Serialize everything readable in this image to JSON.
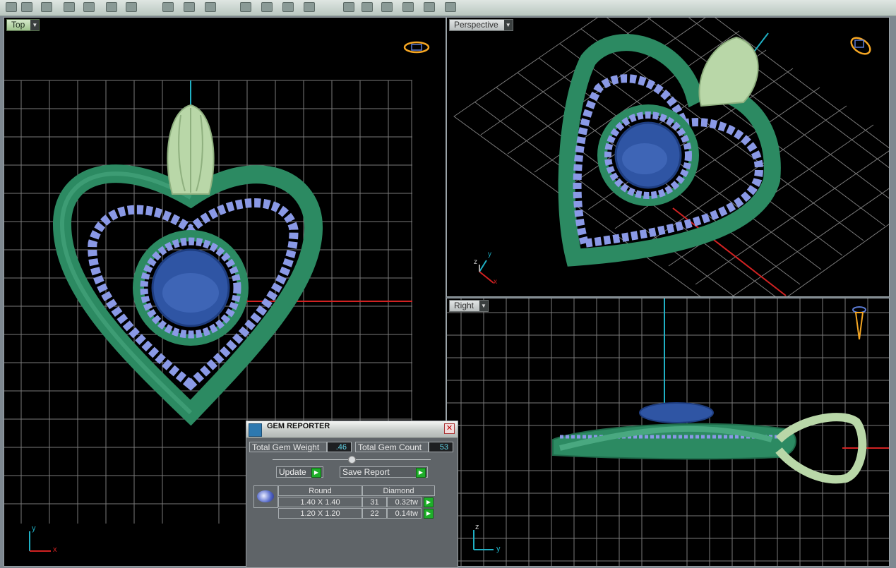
{
  "viewports": {
    "top": {
      "label": "Top"
    },
    "perspective": {
      "label": "Perspective"
    },
    "right": {
      "label": "Right"
    }
  },
  "axes": {
    "x": "x",
    "y": "y",
    "z": "z"
  },
  "gem_reporter": {
    "title": "GEM REPORTER",
    "total_weight_label": "Total Gem Weight",
    "total_weight_value": ".46",
    "total_count_label": "Total Gem Count",
    "total_count_value": "53",
    "update_label": "Update",
    "save_label": "Save Report",
    "table": {
      "headers": [
        "Round",
        "Diamond"
      ],
      "rows": [
        {
          "size": "1.40 X 1.40",
          "count": "31",
          "weight": "0.32tw"
        },
        {
          "size": "1.20 X 1.20",
          "count": "22",
          "weight": "0.14tw"
        }
      ]
    }
  },
  "colors": {
    "metal": "#2c8a62",
    "bail": "#b9d7a8",
    "center_stone": "#2f55a4",
    "accent_stones": "#8a99e6",
    "grid": "#7d7d7d",
    "axis_x": "#d22222",
    "axis_y": "#1fb0c4"
  }
}
